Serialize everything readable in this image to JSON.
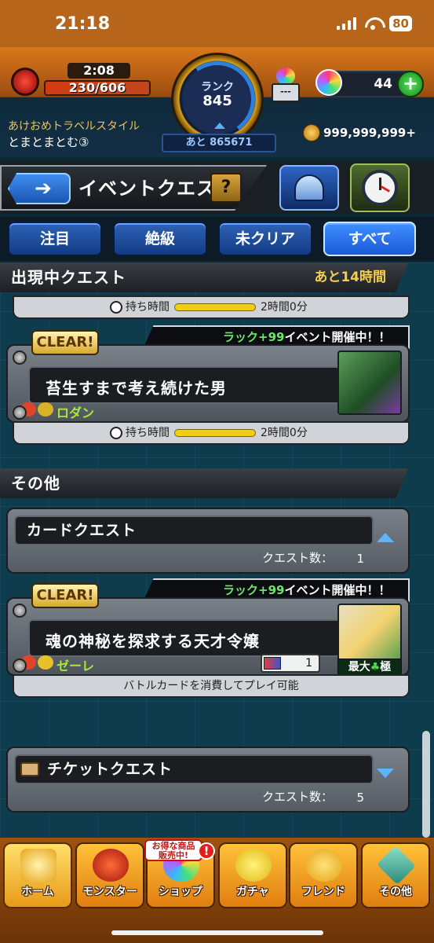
{
  "status_bar": {
    "time": "21:18",
    "battery": "80"
  },
  "header": {
    "stamina_timer": "2:08",
    "stamina": "230/606",
    "rank_label": "ランク",
    "rank": "845",
    "next_rank": "あと 865671",
    "orb_machine_label": "---",
    "orbs": "44",
    "player_title": "あけおめトラベルスタイル",
    "player_name": "とまとまとむ③",
    "coins": "999,999,999+"
  },
  "titlebar": {
    "back_icon": "back-arrow-icon",
    "title": "イベントクエスト",
    "help": "?"
  },
  "tabs": [
    {
      "label": "注目",
      "active": false
    },
    {
      "label": "絶級",
      "active": false
    },
    {
      "label": "未クリア",
      "active": false
    },
    {
      "label": "すべて",
      "active": true
    }
  ],
  "list": {
    "appearing_section": {
      "label": "出現中クエスト",
      "remaining": "あと14時間"
    },
    "time_bar_1": {
      "label": "持ち時間",
      "value": "2時間0分"
    },
    "quest_1": {
      "badge": "CLEAR!",
      "event_prefix": "ラック+99",
      "event_suffix": "イベント開催中！！",
      "name": "苔生すまで考え続けた男",
      "boss": "ロダン"
    },
    "time_bar_2": {
      "label": "持ち時間",
      "value": "2時間0分"
    },
    "other_section": {
      "label": "その他"
    },
    "card_folder": {
      "title": "カードクエスト",
      "count_label": "クエスト数：",
      "count": "1"
    },
    "quest_2": {
      "badge": "CLEAR!",
      "event_prefix": "ラック+99",
      "event_suffix": "イベント開催中！！",
      "name": "魂の神秘を探求する天才令嬢",
      "boss": "ゼーレ",
      "cards": "1",
      "max_tag_prefix": "最大",
      "max_tag_clover": "♣",
      "max_tag_suffix": "極",
      "note": "バトルカードを消費してプレイ可能"
    },
    "ticket_folder": {
      "title": "チケットクエスト",
      "count_label": "クエスト数：",
      "count": "5"
    }
  },
  "bottom_nav": {
    "sale_badge_1": "お得な商品",
    "sale_badge_2": "販売中!",
    "alert": "!",
    "items": [
      {
        "label": "ホーム",
        "icon": "home-icon"
      },
      {
        "label": "モンスター",
        "icon": "monster-icon"
      },
      {
        "label": "ショップ",
        "icon": "shop-icon"
      },
      {
        "label": "ガチャ",
        "icon": "gacha-icon"
      },
      {
        "label": "フレンド",
        "icon": "friend-icon"
      },
      {
        "label": "その他",
        "icon": "other-icon"
      }
    ]
  },
  "colors": {
    "accent": "#2e63b6",
    "header_orange": "#d9781b",
    "clear_gold": "#d7a92b",
    "boss_green": "#a7ea3a"
  }
}
